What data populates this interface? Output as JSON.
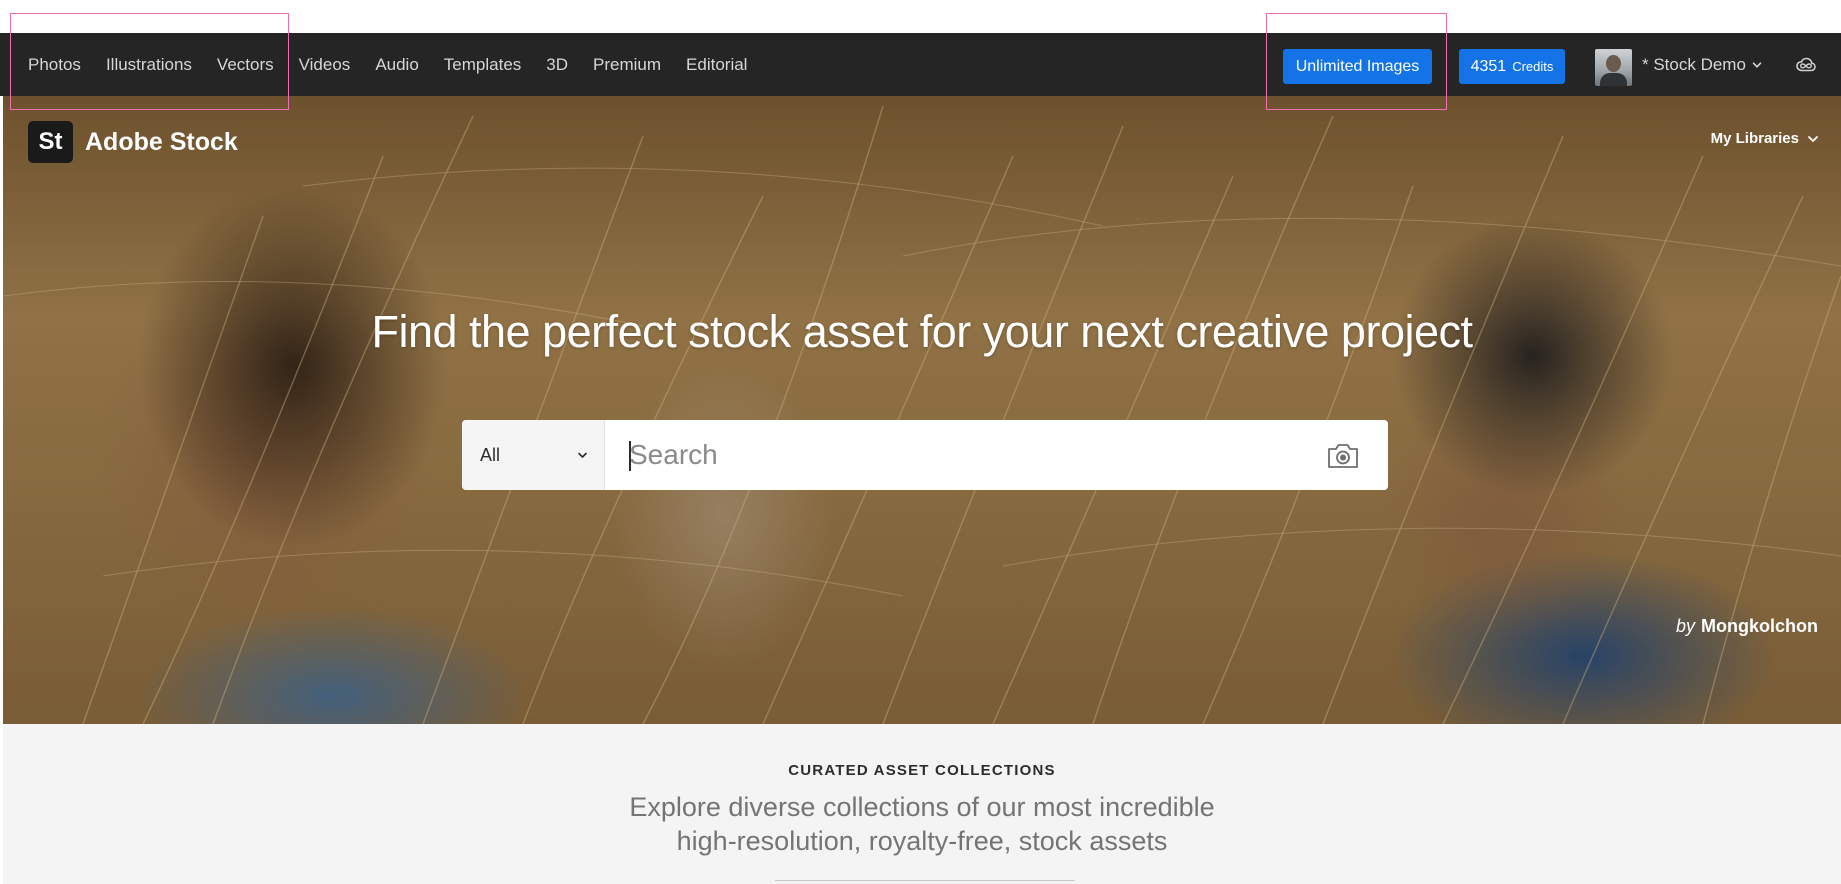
{
  "nav": {
    "items": [
      "Photos",
      "Illustrations",
      "Vectors",
      "Videos",
      "Audio",
      "Templates",
      "3D",
      "Premium",
      "Editorial"
    ],
    "unlimited_label": "Unlimited Images",
    "credits_count": "4351",
    "credits_label": "Credits",
    "account_name": "* Stock Demo",
    "icons": {
      "account_chevron": "chevron-down-icon",
      "creative_cloud": "creative-cloud-icon"
    }
  },
  "hero": {
    "logo_mark": "St",
    "logo_text": "Adobe Stock",
    "my_libraries": "My Libraries",
    "title": "Find the perfect stock asset for your next creative project",
    "search": {
      "category": "All",
      "placeholder": "Search",
      "camera_icon": "camera-icon"
    },
    "credit_by": "by",
    "credit_name": "Mongkolchon"
  },
  "curated": {
    "eyebrow": "CURATED ASSET COLLECTIONS",
    "line1": "Explore diverse collections of our most incredible",
    "line2": "high-resolution, royalty-free, stock assets"
  },
  "colors": {
    "nav_bg": "#252525",
    "accent_blue": "#1473e6",
    "highlight_pink": "#f06fb0",
    "section_bg": "#f4f4f4"
  }
}
